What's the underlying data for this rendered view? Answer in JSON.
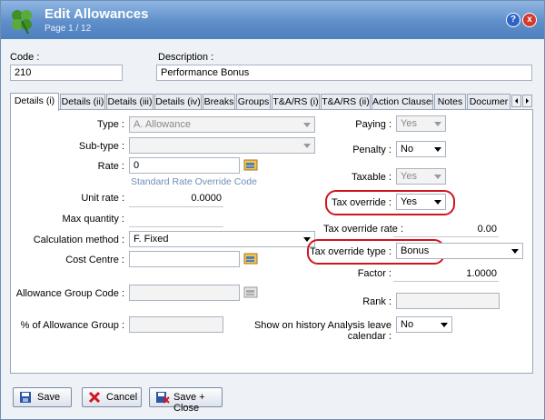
{
  "window": {
    "title": "Edit Allowances",
    "page": "Page 1 / 12",
    "help": "?",
    "close": "x"
  },
  "header": {
    "code_label": "Code :",
    "code_value": "210",
    "description_label": "Description :",
    "description_value": "Performance Bonus"
  },
  "tabs": [
    "Details (i)",
    "Details (ii)",
    "Details (iii)",
    "Details (iv)",
    "Breaks",
    "Groups",
    "T&A/RS (i)",
    "T&A/RS (ii)",
    "Action Clauses",
    "Notes",
    "Documer"
  ],
  "left": {
    "type_label": "Type :",
    "type_value": "A. Allowance",
    "subtype_label": "Sub-type :",
    "subtype_value": "",
    "rate_label": "Rate :",
    "rate_value": "0",
    "rate_override_link": "Standard Rate Override Code",
    "unit_rate_label": "Unit rate :",
    "unit_rate_value": "0.0000",
    "max_qty_label": "Max quantity :",
    "max_qty_value": "",
    "calc_label": "Calculation method :",
    "calc_value": "F. Fixed",
    "cost_centre_label": "Cost Centre :",
    "cost_centre_value": "",
    "agc_label": "Allowance Group Code :",
    "agc_value": "",
    "pag_label": "% of Allowance Group :",
    "pag_value": ""
  },
  "right": {
    "paying_label": "Paying :",
    "paying_value": "Yes",
    "penalty_label": "Penalty :",
    "penalty_value": "No",
    "taxable_label": "Taxable :",
    "taxable_value": "Yes",
    "tax_override_label": "Tax override :",
    "tax_override_value": "Yes",
    "tax_rate_label": "Tax override rate :",
    "tax_rate_value": "0.00",
    "tax_type_label": "Tax override type :",
    "tax_type_value": "Bonus",
    "factor_label": "Factor :",
    "factor_value": "1.0000",
    "rank_label": "Rank :",
    "rank_value": "",
    "history_label": "Show on history Analysis leave calendar :",
    "history_value": "No"
  },
  "buttons": {
    "save": "Save",
    "cancel": "Cancel",
    "save_close": "Save + Close"
  },
  "colors": {
    "highlight": "#d0151d",
    "title_bar": "#5f8fc9"
  }
}
